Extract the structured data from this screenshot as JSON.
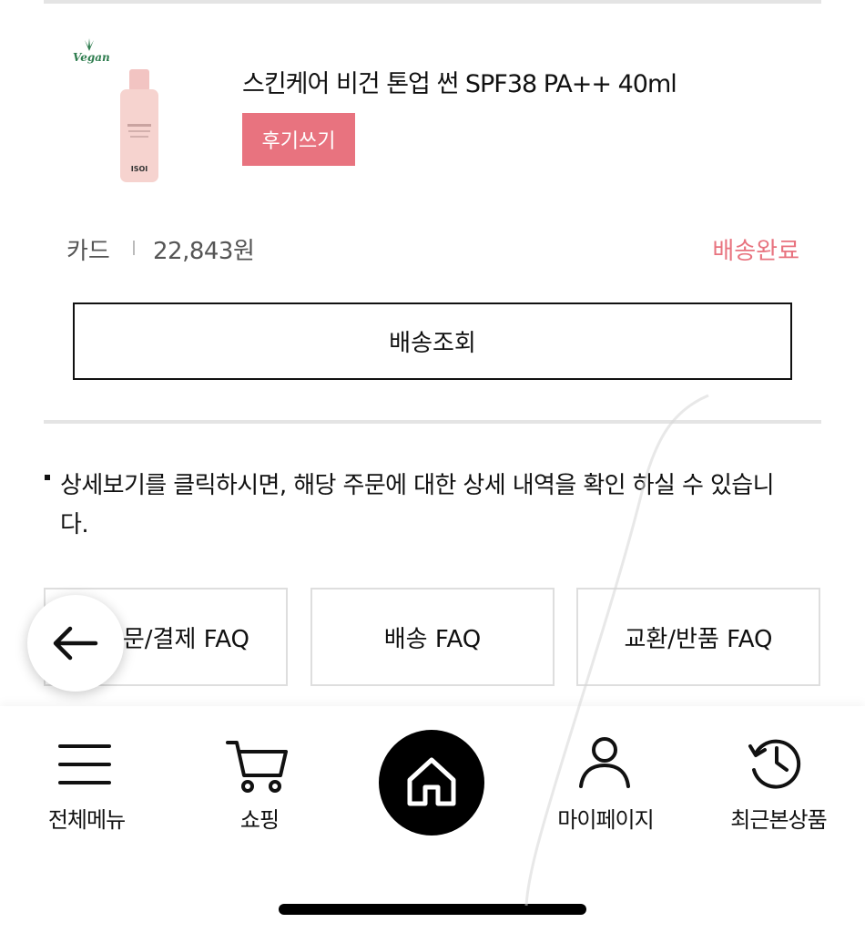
{
  "product": {
    "badge": "Vegan",
    "bottle_label": "ISOI",
    "name": "스킨케어 비건 톤업 썬 SPF38 PA++ 40ml",
    "review_button": "후기쓰기"
  },
  "order": {
    "payment_method": "카드",
    "amount": "22,843원",
    "status": "배송완료",
    "status_color": "#e8737f",
    "track_button": "배송조회"
  },
  "notice": {
    "text": "상세보기를 클릭하시면, 해당 주문에 대한 상세 내역을 확인 하실 수 있습니다."
  },
  "faq": [
    {
      "label": "주문/결제 FAQ"
    },
    {
      "label": "배송 FAQ"
    },
    {
      "label": "교환/반품 FAQ"
    }
  ],
  "back_button": {
    "icon": "arrow-left-icon"
  },
  "bottom_nav": {
    "items": [
      {
        "label": "전체메뉴",
        "icon": "menu-icon"
      },
      {
        "label": "쇼핑",
        "icon": "cart-icon"
      },
      {
        "label": "",
        "icon": "home-icon"
      },
      {
        "label": "마이페이지",
        "icon": "user-icon"
      },
      {
        "label": "최근본상품",
        "icon": "history-icon"
      }
    ]
  },
  "colors": {
    "accent": "#e8737f",
    "divider": "#e4e4e4",
    "home_button": "#000000"
  }
}
